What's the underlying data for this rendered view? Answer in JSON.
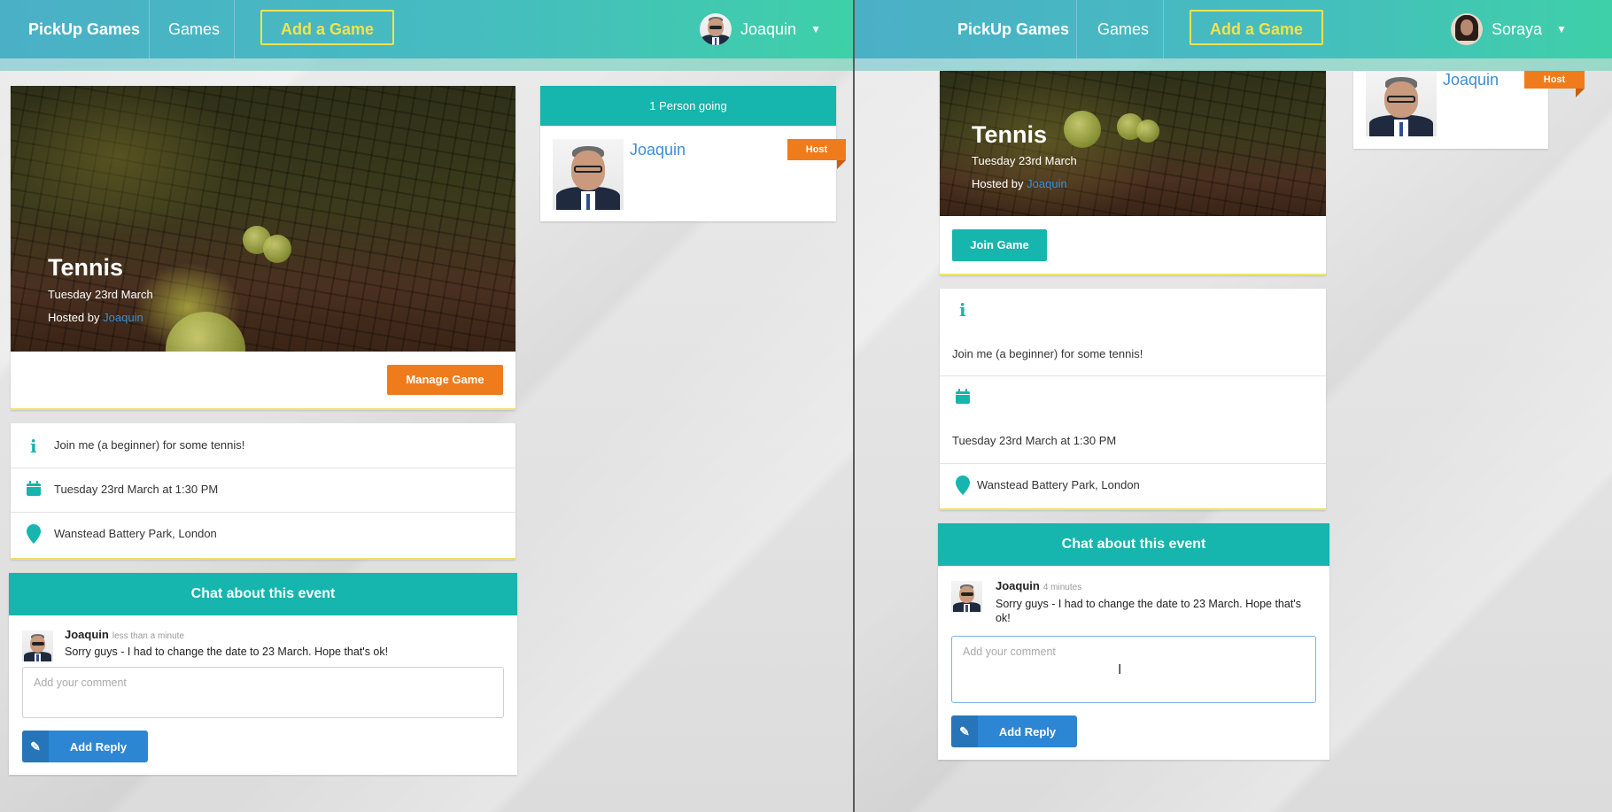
{
  "left": {
    "nav": {
      "brand": "PickUp Games",
      "games": "Games",
      "add_game": "Add a Game",
      "user": "Joaquin"
    },
    "event": {
      "title": "Tennis",
      "date": "Tuesday 23rd March",
      "hosted_by_prefix": "Hosted by",
      "host_name": "Joaquin",
      "manage_button": "Manage Game"
    },
    "details": {
      "description": "Join me (a beginner) for some tennis!",
      "datetime": "Tuesday 23rd March at 1:30 PM",
      "location": "Wanstead Battery Park, London"
    },
    "chat": {
      "title": "Chat about this event",
      "author": "Joaquin",
      "time": "less than a minute",
      "text": "Sorry guys - I had to change the date to 23 March. Hope that's ok!",
      "placeholder": "Add your comment",
      "reply_button": "Add Reply"
    },
    "attendees": {
      "header": "1 Person going",
      "name": "Joaquin",
      "tag": "Host"
    }
  },
  "right": {
    "nav": {
      "brand": "PickUp Games",
      "games": "Games",
      "add_game": "Add a Game",
      "user": "Soraya"
    },
    "attendees": {
      "name": "Joaquin",
      "tag": "Host"
    },
    "event": {
      "title": "Tennis",
      "date": "Tuesday 23rd March",
      "hosted_by_prefix": "Hosted by",
      "host_name": "Joaquin",
      "join_button": "Join Game"
    },
    "details": {
      "description": "Join me (a beginner) for some tennis!",
      "datetime": "Tuesday 23rd March at 1:30 PM",
      "location": "Wanstead Battery Park, London"
    },
    "chat": {
      "title": "Chat about this event",
      "author": "Joaquin",
      "time": "4 minutes",
      "text": "Sorry guys - I had to change the date to 23 March. Hope that's ok!",
      "placeholder": "Add your comment",
      "reply_button": "Add Reply"
    }
  },
  "colors": {
    "teal": "#16b5ad",
    "orange": "#ef7c1c",
    "blue": "#2d86d3",
    "nav_yellow": "#f5e24a"
  },
  "icons": [
    "info-icon",
    "calendar-icon",
    "map-marker-icon",
    "edit-icon",
    "caret-down-icon"
  ]
}
